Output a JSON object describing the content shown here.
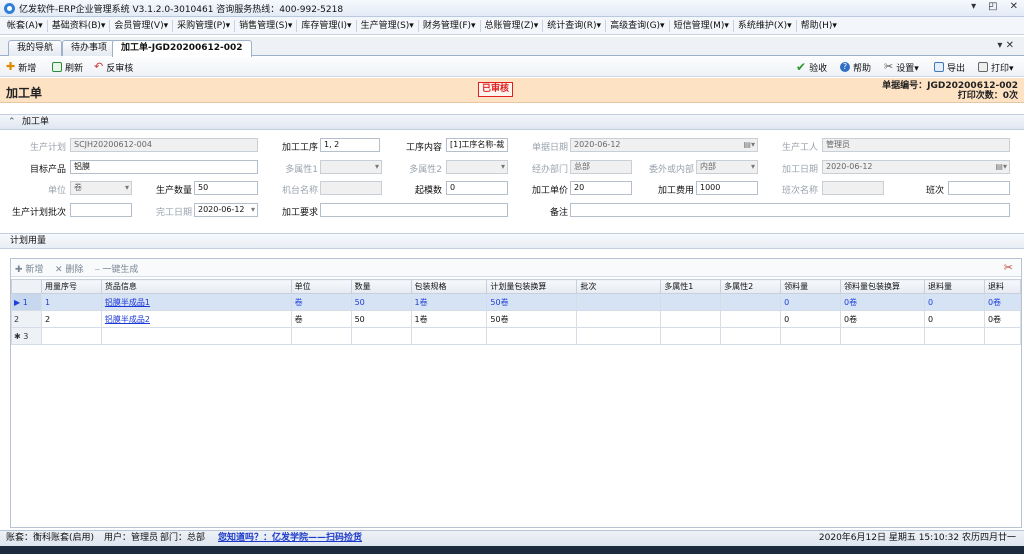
{
  "window": {
    "title": "亿发软件-ERP企业管理系统 V3.1.2.0-3010461 咨询服务热线：400-992-5218",
    "controls": [
      "▾",
      "◰",
      "✕"
    ]
  },
  "menu": [
    "帐套(A)▾",
    "基础资料(B)▾",
    "会员管理(V)▾",
    "采购管理(P)▾",
    "销售管理(S)▾",
    "库存管理(I)▾",
    "生产管理(S)▾",
    "财务管理(F)▾",
    "总账管理(Z)▾",
    "统计查询(R)▾",
    "高级查询(G)▾",
    "短信管理(M)▾",
    "系统维护(X)▾",
    "帮助(H)▾"
  ],
  "tabs": [
    "我的导航",
    "待办事项",
    "加工单-JGD20200612-002"
  ],
  "tab_close": "▾ ✕",
  "toolbar": {
    "new": "新增",
    "refresh": "刷新",
    "unaudit": "反审核",
    "accept": "验收",
    "help": "帮助",
    "settings": "设置▾",
    "export": "导出",
    "print": "打印▾"
  },
  "header": {
    "title": "加工单",
    "stamp": "已审核",
    "doc_no_label": "单据编号：",
    "doc_no": "JGD20200612-002",
    "print_count": "打印次数：0次"
  },
  "sections": {
    "form": "加工单",
    "plan": "计划用量"
  },
  "form": {
    "plan_no_label": "生产计划",
    "plan_no": "SCJH20200612-004",
    "process_label": "加工工序",
    "process": "1, 2",
    "content_label": "工序内容",
    "content": "[1]工序名称-裁",
    "date_label": "单据日期",
    "date": "2020-06-12",
    "worker_label": "生产工人",
    "worker": "管理员",
    "target_label": "目标产品",
    "target": "铝膜",
    "attr1_label": "多属性1",
    "attr2_label": "多属性2",
    "dept_label": "经办部门",
    "dept": "总部",
    "outsource_label": "委外或内部",
    "outsource": "内部",
    "proc_date_label": "加工日期",
    "proc_date": "2020-06-12",
    "unit_label": "单位",
    "unit": "卷",
    "qty_label": "生产数量",
    "qty": "50",
    "machine_label": "机台名称",
    "start_label": "起模数",
    "start": "0",
    "price_label": "加工单价",
    "price": "20",
    "fee_label": "加工费用",
    "fee": "1000",
    "shift_name_label": "班次名称",
    "shift_label": "班次",
    "batch_label": "生产计划批次",
    "finish_label": "完工日期",
    "finish": "2020-06-12",
    "req_label": "加工要求",
    "note_label": "备注"
  },
  "grid": {
    "toolbar": {
      "new": "新增",
      "delete": "删除",
      "generate": "一键生成"
    },
    "columns": [
      "用量序号",
      "货品信息",
      "单位",
      "数量",
      "包装规格",
      "计划量包装换算",
      "批次",
      "多属性1",
      "多属性2",
      "领料量",
      "领料量包装换算",
      "退料量",
      "退料"
    ],
    "rows": [
      {
        "marker": "▶",
        "no": "1",
        "seq": "1",
        "goods": "铝膜半成品1",
        "unit": "卷",
        "qty": "50",
        "pack": "1卷",
        "plan_pack": "50卷",
        "batch": "",
        "a1": "",
        "a2": "",
        "pick": "0",
        "pick_pack": "0卷",
        "ret": "0",
        "ret2": "0卷"
      },
      {
        "marker": "",
        "no": "2",
        "seq": "2",
        "goods": "铝膜半成品2",
        "unit": "卷",
        "qty": "50",
        "pack": "1卷",
        "plan_pack": "50卷",
        "batch": "",
        "a1": "",
        "a2": "",
        "pick": "0",
        "pick_pack": "0卷",
        "ret": "0",
        "ret2": "0卷"
      },
      {
        "marker": "✱",
        "no": "3",
        "seq": "",
        "goods": "",
        "unit": "",
        "qty": "",
        "pack": "",
        "plan_pack": "",
        "batch": "",
        "a1": "",
        "a2": "",
        "pick": "",
        "pick_pack": "",
        "ret": "",
        "ret2": ""
      }
    ]
  },
  "status": {
    "account": "账套：衡科账套(启用)",
    "user": "用户：管理员",
    "dept": "部门：总部",
    "link": "您知道吗？：亿发学院——扫码捡货",
    "datetime": "2020年6月12日 星期五 15:10:32 农历四月廿一"
  },
  "colors": {
    "header_band": "#fde3c4",
    "stamp_red": "#e02020",
    "link_blue": "#1a35d8",
    "selected_row": "#d5e3f5"
  }
}
